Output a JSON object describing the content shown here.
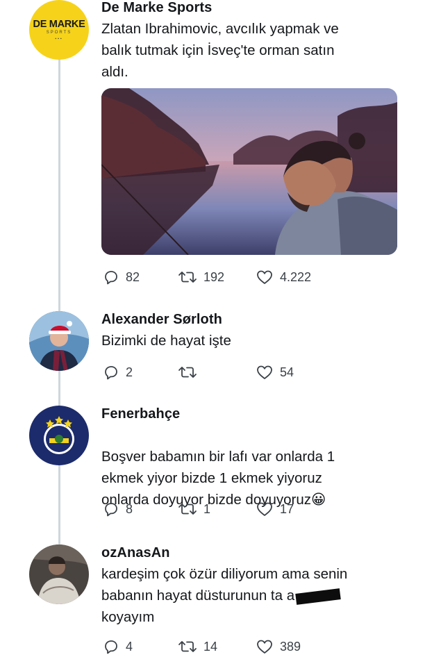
{
  "tweets": [
    {
      "author": "De Marke Sports",
      "avatar_text": "DE MARKE",
      "avatar_subtext": "SPORTS",
      "text": "Zlatan Ibrahimovic, avcılık yapmak ve\nbalık tutmak için İsveç'te orman satın\naldı.",
      "replies": "82",
      "retweets": "192",
      "likes": "4.222"
    },
    {
      "author": "Alexander Sørloth",
      "text": "Bizimki de hayat işte",
      "replies": "2",
      "retweets": "",
      "likes": "54"
    },
    {
      "author": "Fenerbahçe",
      "text": "Boşver babamın bir lafı var onlarda 1\nekmek yiyor bizde 1 ekmek yiyoruz\nonlarda doyuyor bizde doyuyoruz",
      "emoji": "😀",
      "replies": "8",
      "retweets": "1",
      "likes": "17"
    },
    {
      "author": "ozAnasAn",
      "text_lines": [
        "kardeşim çok özür diliyorum ama senin",
        "babanın hayat düsturunun ta a",
        "koyayım"
      ],
      "replies": "4",
      "retweets": "14",
      "likes": "389"
    }
  ],
  "icons": {
    "reply": "reply-icon",
    "retweet": "retweet-icon",
    "like": "heart-icon"
  },
  "colors": {
    "icon": "#3a4147",
    "thread_line": "#cfd6dc",
    "demarke_yellow": "#f6d31a",
    "fenerbahce_navy": "#1c2b6b"
  }
}
